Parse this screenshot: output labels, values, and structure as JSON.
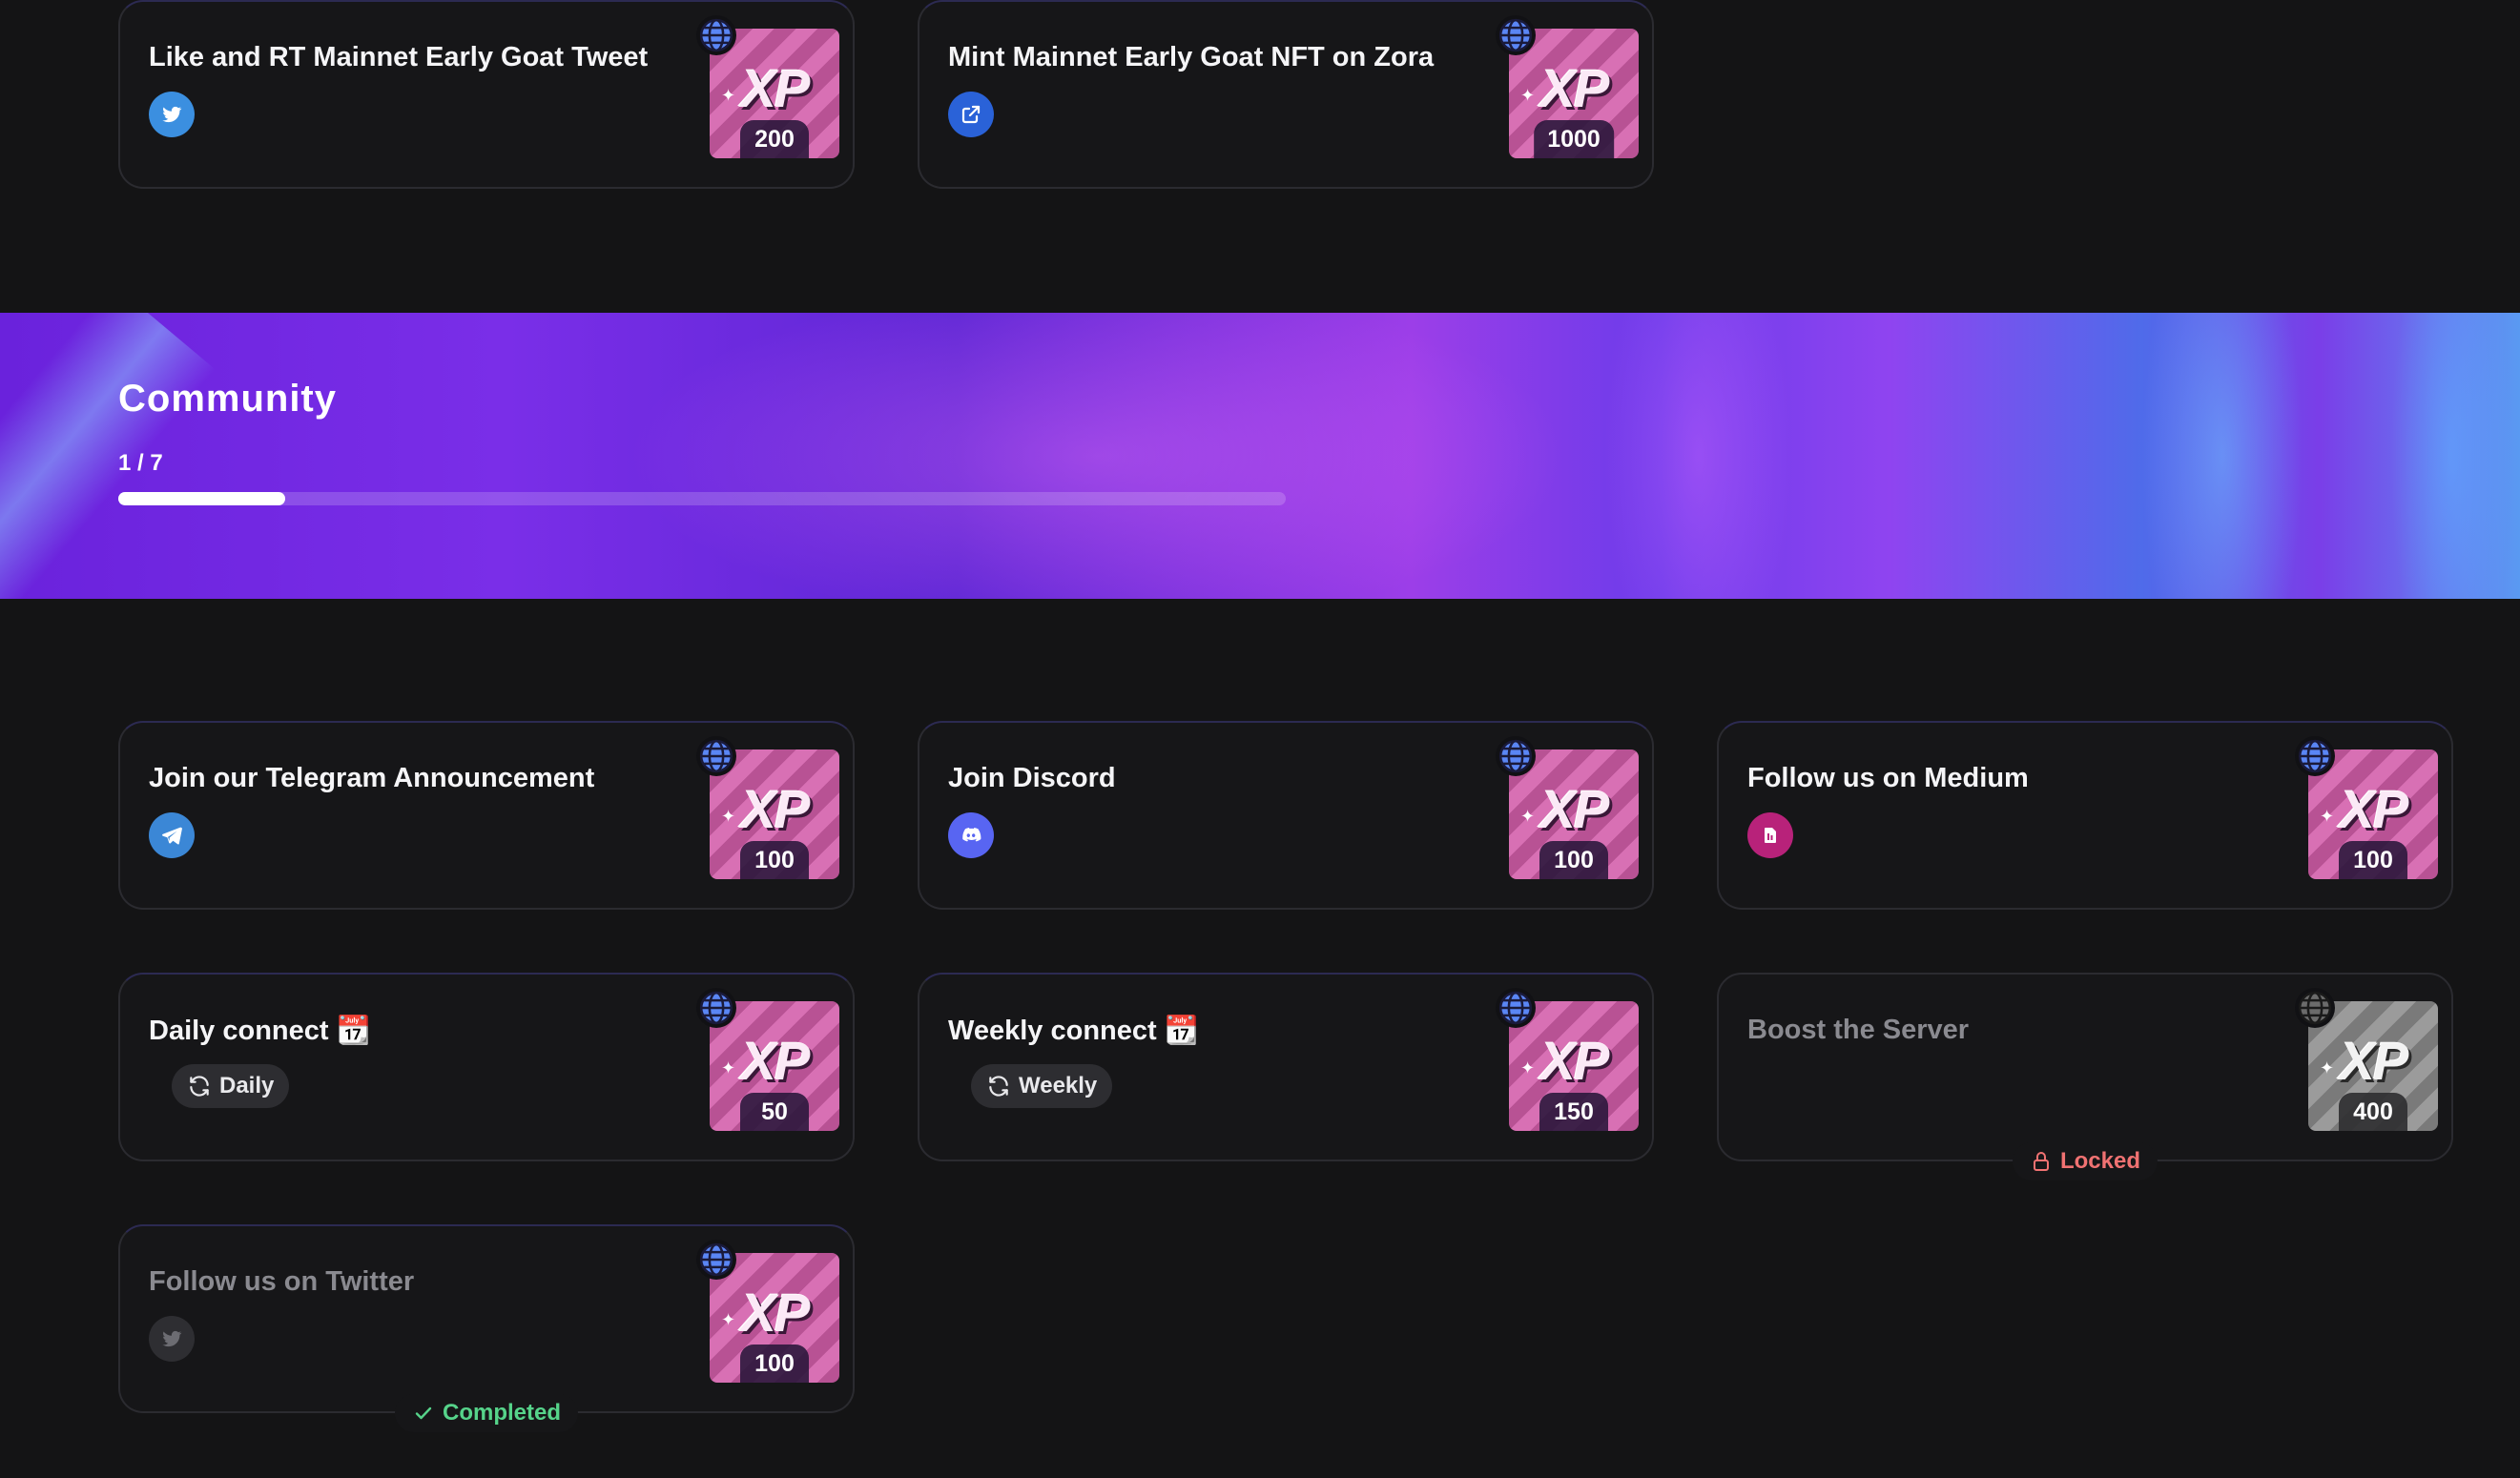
{
  "top_quests": [
    {
      "title": "Like and RT Mainnet Early Goat Tweet",
      "xp": "200",
      "icon": "twitter-icon"
    },
    {
      "title": "Mint Mainnet Early Goat NFT on Zora",
      "xp": "1000",
      "icon": "external-link-icon"
    }
  ],
  "community": {
    "title": "Community",
    "progress_text": "1 / 7",
    "progress_fraction": 0.1428
  },
  "quests": [
    {
      "title": "Join our Telegram Announcement",
      "xp": "100",
      "icon": "telegram-icon"
    },
    {
      "title": "Join Discord",
      "xp": "100",
      "icon": "discord-icon"
    },
    {
      "title": "Follow us on Medium",
      "xp": "100",
      "icon": "medium-icon"
    },
    {
      "title": "Daily connect 📆",
      "xp": "50",
      "pill": "Daily"
    },
    {
      "title": "Weekly connect 📆",
      "xp": "150",
      "pill": "Weekly"
    },
    {
      "title": "Boost the Server",
      "xp": "400",
      "status": "Locked"
    },
    {
      "title": "Follow us on Twitter",
      "xp": "100",
      "icon": "twitter-icon",
      "status": "Completed"
    }
  ],
  "xp_label": "XP",
  "colors": {
    "background": "#141415",
    "card_border": "#2b2b30",
    "twitter": "#3b8fe0",
    "link": "#2a62d8",
    "telegram": "#3b87d6",
    "discord": "#5865f2",
    "medium": "#b8227a",
    "locked": "#f07272",
    "completed": "#56d38a"
  }
}
